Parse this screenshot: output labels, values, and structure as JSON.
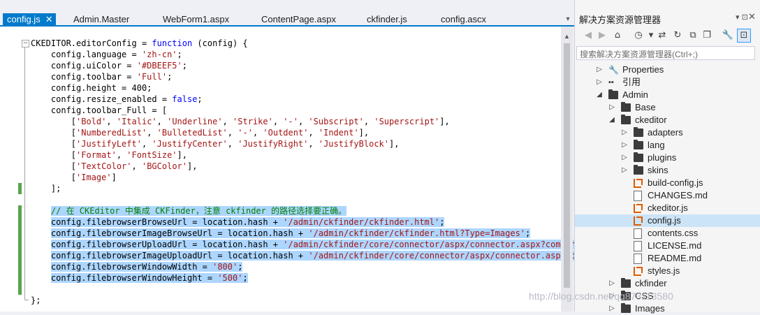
{
  "tabs": [
    {
      "label": "config.js",
      "active": true,
      "close": "✕"
    },
    {
      "label": "Admin.Master"
    },
    {
      "label": "WebForm1.aspx"
    },
    {
      "label": "ContentPage.aspx"
    },
    {
      "label": "ckfinder.js"
    },
    {
      "label": "config.ascx"
    }
  ],
  "editor": {
    "lines": [
      [
        {
          "t": "CKEDITOR.editorConfig = "
        },
        {
          "t": "function",
          "c": "kw"
        },
        {
          "t": " (config) {"
        }
      ],
      [
        {
          "t": "    config.language = "
        },
        {
          "t": "'zh-cn'",
          "c": "str"
        },
        {
          "t": ";"
        }
      ],
      [
        {
          "t": "    config.uiColor = "
        },
        {
          "t": "'#DBEEF5'",
          "c": "str"
        },
        {
          "t": ";"
        }
      ],
      [
        {
          "t": "    config.toolbar = "
        },
        {
          "t": "'Full'",
          "c": "str"
        },
        {
          "t": ";"
        }
      ],
      [
        {
          "t": "    config.height = 400;"
        }
      ],
      [
        {
          "t": "    config.resize_enabled = "
        },
        {
          "t": "false",
          "c": "kw"
        },
        {
          "t": ";"
        }
      ],
      [
        {
          "t": "    config.toolbar_Full = ["
        }
      ],
      [
        {
          "t": "        ["
        },
        {
          "t": "'Bold'",
          "c": "str"
        },
        {
          "t": ", "
        },
        {
          "t": "'Italic'",
          "c": "str"
        },
        {
          "t": ", "
        },
        {
          "t": "'Underline'",
          "c": "str"
        },
        {
          "t": ", "
        },
        {
          "t": "'Strike'",
          "c": "str"
        },
        {
          "t": ", "
        },
        {
          "t": "'-'",
          "c": "str"
        },
        {
          "t": ", "
        },
        {
          "t": "'Subscript'",
          "c": "str"
        },
        {
          "t": ", "
        },
        {
          "t": "'Superscript'",
          "c": "str"
        },
        {
          "t": "],"
        }
      ],
      [
        {
          "t": "        ["
        },
        {
          "t": "'NumberedList'",
          "c": "str"
        },
        {
          "t": ", "
        },
        {
          "t": "'BulletedList'",
          "c": "str"
        },
        {
          "t": ", "
        },
        {
          "t": "'-'",
          "c": "str"
        },
        {
          "t": ", "
        },
        {
          "t": "'Outdent'",
          "c": "str"
        },
        {
          "t": ", "
        },
        {
          "t": "'Indent'",
          "c": "str"
        },
        {
          "t": "],"
        }
      ],
      [
        {
          "t": "        ["
        },
        {
          "t": "'JustifyLeft'",
          "c": "str"
        },
        {
          "t": ", "
        },
        {
          "t": "'JustifyCenter'",
          "c": "str"
        },
        {
          "t": ", "
        },
        {
          "t": "'JustifyRight'",
          "c": "str"
        },
        {
          "t": ", "
        },
        {
          "t": "'JustifyBlock'",
          "c": "str"
        },
        {
          "t": "],"
        }
      ],
      [
        {
          "t": "        ["
        },
        {
          "t": "'Format'",
          "c": "str"
        },
        {
          "t": ", "
        },
        {
          "t": "'FontSize'",
          "c": "str"
        },
        {
          "t": "],"
        }
      ],
      [
        {
          "t": "        ["
        },
        {
          "t": "'TextColor'",
          "c": "str"
        },
        {
          "t": ", "
        },
        {
          "t": "'BGColor'",
          "c": "str"
        },
        {
          "t": "],"
        }
      ],
      [
        {
          "t": "        ["
        },
        {
          "t": "'Image'",
          "c": "str"
        },
        {
          "t": "]"
        }
      ],
      [
        {
          "t": "    ];"
        }
      ],
      [
        {
          "t": ""
        }
      ],
      [
        {
          "t": "    "
        },
        {
          "t": "// 在 CKEditor 中集成 CKFinder，注意 ckfinder 的路径选择要正确。",
          "c": "cm",
          "s": true
        }
      ],
      [
        {
          "t": "    "
        },
        {
          "t": "config.filebrowserBrowseUrl = location.hash + ",
          "s": true
        },
        {
          "t": "'/admin/ckfinder/ckfinder.html'",
          "c": "str",
          "s": true
        },
        {
          "t": ";",
          "s": true
        }
      ],
      [
        {
          "t": "    "
        },
        {
          "t": "config.filebrowserImageBrowseUrl = location.hash + ",
          "s": true
        },
        {
          "t": "'/admin/ckfinder/ckfinder.html?Type=Images'",
          "c": "str",
          "s": true
        },
        {
          "t": ";",
          "s": true
        }
      ],
      [
        {
          "t": "    "
        },
        {
          "t": "config.filebrowserUploadUrl = location.hash + ",
          "s": true
        },
        {
          "t": "'/admin/ckfinder/core/connector/aspx/connector.aspx?command",
          "c": "str",
          "s": true
        }
      ],
      [
        {
          "t": "    "
        },
        {
          "t": "config.filebrowserImageUploadUrl = location.hash + ",
          "s": true
        },
        {
          "t": "'/admin/ckfinder/core/connector/aspx/connector.aspx?co",
          "c": "str",
          "s": true
        }
      ],
      [
        {
          "t": "    "
        },
        {
          "t": "config.filebrowserWindowWidth = ",
          "s": true
        },
        {
          "t": "'800'",
          "c": "str",
          "s": true
        },
        {
          "t": ";",
          "s": true
        }
      ],
      [
        {
          "t": "    "
        },
        {
          "t": "config.filebrowserWindowHeight = ",
          "s": true
        },
        {
          "t": "'500'",
          "c": "str",
          "s": true
        },
        {
          "t": ";",
          "s": true
        }
      ],
      [
        {
          "t": ""
        }
      ],
      [
        {
          "t": "};"
        }
      ]
    ]
  },
  "panel": {
    "title": "解决方案资源管理器",
    "pin": "▾ ⊡",
    "close": "✕",
    "search_placeholder": "搜索解决方案资源管理器(Ctrl+;)",
    "toolbar": [
      {
        "icon": "back-icon",
        "glyph": "◀",
        "disabled": true
      },
      {
        "icon": "forward-icon",
        "glyph": "▶",
        "disabled": true
      },
      {
        "icon": "home-icon",
        "glyph": "⌂"
      },
      {
        "icon": "history-icon",
        "glyph": "◷"
      },
      {
        "icon": "dropdown-icon",
        "glyph": "▾"
      },
      {
        "icon": "sync-icon",
        "glyph": "⇄"
      },
      {
        "icon": "refresh-icon",
        "glyph": "↻"
      },
      {
        "icon": "collapse-all-icon",
        "glyph": "⧉"
      },
      {
        "icon": "copy-icon",
        "glyph": "❐"
      },
      {
        "icon": "properties-icon",
        "glyph": "🔧"
      },
      {
        "icon": "preview-icon",
        "glyph": "⊡",
        "pressed": true
      }
    ],
    "tree": [
      {
        "label": "Properties",
        "depth": 0,
        "icon": "wrench",
        "expand": "collapsed"
      },
      {
        "label": "引用",
        "depth": 0,
        "icon": "references",
        "expand": "collapsed"
      },
      {
        "label": "Admin",
        "depth": 0,
        "icon": "folder",
        "expand": "expanded"
      },
      {
        "label": "Base",
        "depth": 1,
        "icon": "folder",
        "expand": "collapsed"
      },
      {
        "label": "ckeditor",
        "depth": 1,
        "icon": "folder",
        "expand": "expanded"
      },
      {
        "label": "adapters",
        "depth": 2,
        "icon": "folder",
        "expand": "collapsed"
      },
      {
        "label": "lang",
        "depth": 2,
        "icon": "folder",
        "expand": "collapsed"
      },
      {
        "label": "plugins",
        "depth": 2,
        "icon": "folder",
        "expand": "collapsed"
      },
      {
        "label": "skins",
        "depth": 2,
        "icon": "folder",
        "expand": "collapsed"
      },
      {
        "label": "build-config.js",
        "depth": 2,
        "icon": "js"
      },
      {
        "label": "CHANGES.md",
        "depth": 2,
        "icon": "doc"
      },
      {
        "label": "ckeditor.js",
        "depth": 2,
        "icon": "js"
      },
      {
        "label": "config.js",
        "depth": 2,
        "icon": "js",
        "selected": true
      },
      {
        "label": "contents.css",
        "depth": 2,
        "icon": "css"
      },
      {
        "label": "LICENSE.md",
        "depth": 2,
        "icon": "doc"
      },
      {
        "label": "README.md",
        "depth": 2,
        "icon": "doc"
      },
      {
        "label": "styles.js",
        "depth": 2,
        "icon": "js"
      },
      {
        "label": "ckfinder",
        "depth": 1,
        "icon": "folder",
        "expand": "collapsed"
      },
      {
        "label": "CSS",
        "depth": 1,
        "icon": "folder",
        "expand": "collapsed"
      },
      {
        "label": "Images",
        "depth": 1,
        "icon": "folder",
        "expand": "collapsed"
      }
    ]
  },
  "watermark": "http://blog.csdn.net/qq873113580",
  "colors": {
    "accent": "#007acc",
    "selection": "#add6ff",
    "keyword": "#0000ff",
    "string": "#a31515",
    "comment": "#008000",
    "js_icon": "#e05a00"
  }
}
